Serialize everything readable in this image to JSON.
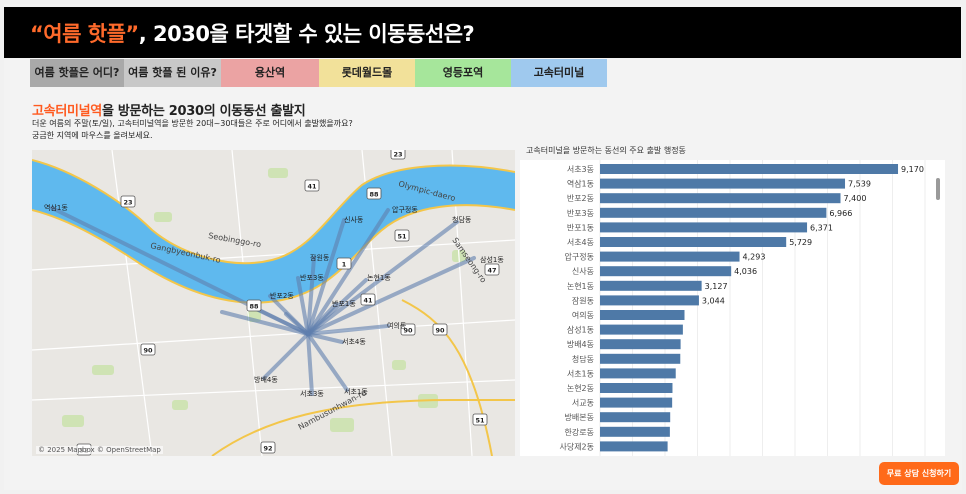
{
  "header": {
    "title_highlight": "“여름 핫플”",
    "title_rest": ", 2030을 타겟할 수 있는 이동동선은?"
  },
  "tabs": [
    {
      "label": "여름 핫플은 어디?",
      "color": "#a9a9a9",
      "width": 94
    },
    {
      "label": "여름 핫플 된 이유?",
      "color": "#c8c8c8",
      "width": 97
    },
    {
      "label": "용산역",
      "color": "#eba3a3",
      "width": 98
    },
    {
      "label": "롯데월드몰",
      "color": "#f2e19a",
      "width": 96
    },
    {
      "label": "영등포역",
      "color": "#a6e69b",
      "width": 96
    },
    {
      "label": "고속터미널",
      "color": "#9fc9ee",
      "width": 96
    }
  ],
  "section": {
    "title_highlight": "고속터미널역",
    "title_rest": "을 방문하는 2030의 이동동선 출발지",
    "desc_line1": "더운 여름의 주말(토/일), 고속터미널역을 방문한 20대~30대들은 주로 어디에서 출발했을까요?",
    "desc_line2": "궁금한 지역에 마우스를 올려보세요."
  },
  "map": {
    "attribution": "© 2025 Mapbox © OpenStreetMap",
    "road_labels": [
      {
        "text": "Gangbyeonbuk-ro"
      },
      {
        "text": "Seobinggo-ro"
      },
      {
        "text": "Olympic-daero"
      },
      {
        "text": "Samseong-ro"
      },
      {
        "text": "Nambusunhwan-ro"
      }
    ],
    "route_shields": [
      "23",
      "41",
      "88",
      "51",
      "1",
      "47",
      "90",
      "92",
      "88",
      "41",
      "90",
      "23",
      "90",
      "92",
      "51"
    ],
    "district_labels": [
      {
        "text": "역삼1동"
      },
      {
        "text": "서초3동"
      },
      {
        "text": "반포2동"
      },
      {
        "text": "반포3동"
      },
      {
        "text": "반포1동"
      },
      {
        "text": "압구정동"
      },
      {
        "text": "신사동"
      },
      {
        "text": "청담동"
      },
      {
        "text": "논현1동"
      },
      {
        "text": "서초4동"
      },
      {
        "text": "방배4동"
      },
      {
        "text": "서초1동"
      },
      {
        "text": "삼성1동"
      },
      {
        "text": "잠원동"
      },
      {
        "text": "여의동"
      }
    ]
  },
  "chart_title": "고속터미널을 방문하는 동선의 주요 출발 행정동",
  "chart_data": {
    "type": "bar",
    "orientation": "horizontal",
    "title": "고속터미널을 방문하는 동선의 주요 출발 행정동",
    "bar_color": "#4e79a7",
    "categories": [
      "서초3동",
      "역삼1동",
      "반포2동",
      "반포3동",
      "반포1동",
      "서초4동",
      "압구정동",
      "신사동",
      "논현1동",
      "잠원동",
      "여의동",
      "삼성1동",
      "방배4동",
      "청담동",
      "서초1동",
      "논현2동",
      "서교동",
      "방배본동",
      "한강로동",
      "사당제2동"
    ],
    "values": [
      9170,
      7539,
      7400,
      6966,
      6371,
      5729,
      4293,
      4036,
      3127,
      3044,
      2600,
      2550,
      2480,
      2470,
      2330,
      2230,
      2220,
      2160,
      2150,
      2080
    ],
    "labels": [
      "9,170",
      "7,539",
      "7,400",
      "6,966",
      "6,371",
      "5,729",
      "4,293",
      "4,036",
      "3,127",
      "3,044",
      "",
      "",
      "",
      "",
      "",
      "",
      "",
      "",
      "",
      ""
    ],
    "xlim": [
      0,
      10000
    ],
    "grid": true
  },
  "cta": {
    "label": "무료 상담 신청하기"
  },
  "colors": {
    "accent": "#ff6a2b",
    "water": "#5fb9ee",
    "route": "#5f7fae"
  }
}
